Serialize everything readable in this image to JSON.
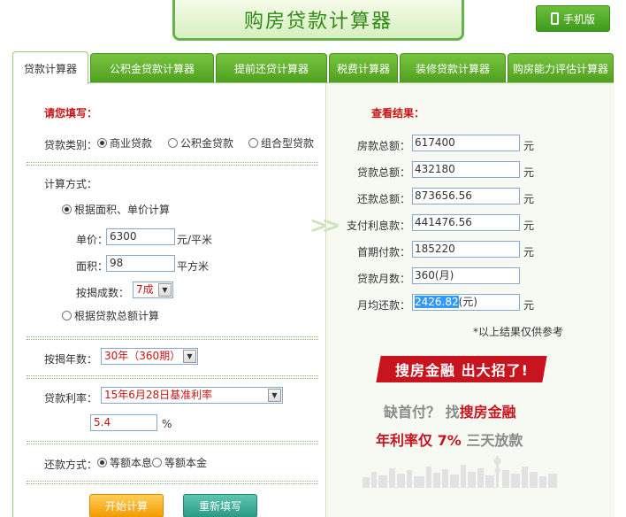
{
  "header": {
    "title": "购房贷款计算器",
    "mobile_label": "手机版"
  },
  "tabs": [
    "贷款计算器",
    "公积金贷款计算器",
    "提前还贷计算器",
    "税费计算器",
    "装修贷款计算器",
    "购房能力评估计算器"
  ],
  "form": {
    "section_title": "请您填写：",
    "loan_type_label": "贷款类别：",
    "loan_types": [
      "商业贷款",
      "公积金贷款",
      "组合型贷款"
    ],
    "calc_method_label": "计算方式：",
    "method_area": "根据面积、单价计算",
    "unit_price_label": "单价：",
    "unit_price_value": "6300",
    "unit_price_unit": "元/平米",
    "area_label": "面积：",
    "area_value": "98",
    "area_unit": "平方米",
    "ratio_label": "按揭成数：",
    "ratio_value": "7成",
    "method_total": "根据贷款总额计算",
    "years_label": "按揭年数：",
    "years_value": "30年（360期）",
    "rate_label": "贷款利率：",
    "rate_value": "15年6月28日基准利率",
    "rate_number": "5.4",
    "rate_unit": "%",
    "repay_label": "还款方式：",
    "repay_options": [
      "等额本息",
      "等额本金"
    ],
    "start_button": "开始计算",
    "reset_button": "重新填写"
  },
  "results": {
    "section_title": "查看结果：",
    "rows": [
      {
        "label": "房款总额：",
        "value": "617400",
        "unit": "元"
      },
      {
        "label": "贷款总额：",
        "value": "432180",
        "unit": "元"
      },
      {
        "label": "还款总额：",
        "value": "873656.56",
        "unit": "元"
      },
      {
        "label": "支付利息款：",
        "value": "441476.56",
        "unit": "元"
      },
      {
        "label": "首期付款：",
        "value": "185220",
        "unit": "元"
      },
      {
        "label": "贷款月数：",
        "value": "360(月)",
        "unit": ""
      },
      {
        "label": "月均还款：",
        "value": "2426.82",
        "value_suffix": "(元)",
        "unit": "元"
      }
    ],
    "note": "*以上结果仅供参考"
  },
  "ad": {
    "banner": "搜房金融 出大招了!",
    "line1_a": "缺首付？ 找",
    "line1_b": "搜房金融",
    "line2_a": "年利率仅 7% ",
    "line2_b": "三天放款"
  },
  "colors": {
    "brand_green": "#4e9f1f",
    "accent_red": "#c81414",
    "start_orange": "#f39b00",
    "reset_teal": "#2a9a84"
  }
}
